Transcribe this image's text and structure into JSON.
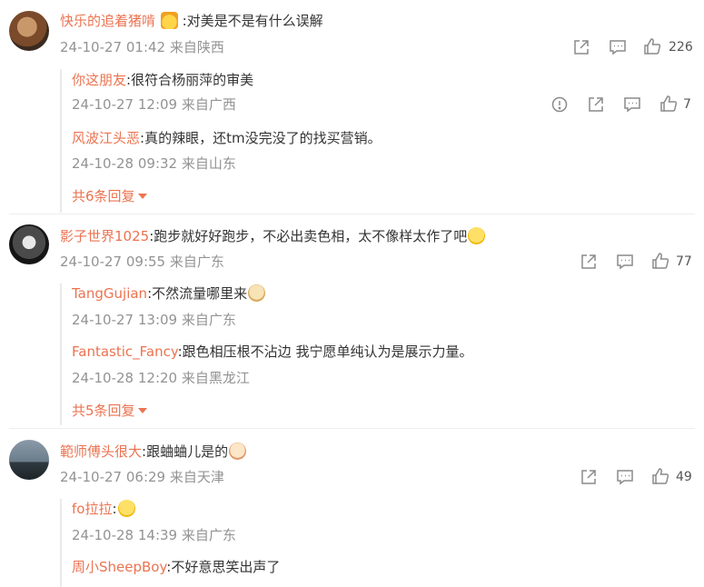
{
  "colors": {
    "username": "#eb7350",
    "meta": "#939393",
    "text": "#333333",
    "accent": "#eb7350"
  },
  "comments": [
    {
      "username": "快乐的追着猪啃",
      "badge_icon": "crown-icon",
      "text": ":对美是不是有什么误解",
      "time": "24-10-27 01:42 来自陕西",
      "likes": "226",
      "replies": [
        {
          "username": "你这朋友",
          "text": ":很符合杨丽萍的审美",
          "time": "24-10-27 12:09 来自广西",
          "likes": "7"
        },
        {
          "username": "风波江头恶",
          "text": ":真的辣眼，还tm没完没了的找买营销。",
          "time": "24-10-28 09:32 来自山东"
        }
      ],
      "more_replies": "共6条回复"
    },
    {
      "username": "影子世界1025",
      "text": ":跑步就好好跑步，不必出卖色相，太不像样太作了吧",
      "emoji": "laugh-cry-emoji",
      "time": "24-10-27 09:55 来自广东",
      "likes": "77",
      "replies": [
        {
          "username": "TangGujian",
          "text": ":不然流量哪里来",
          "emoji": "doge-emoji",
          "time": "24-10-27 13:09 来自广东"
        },
        {
          "username": "Fantastic_Fancy",
          "text": ":跟色相压根不沾边  我宁愿单纯认为是展示力量。",
          "time": "24-10-28 12:20 来自黑龙江"
        }
      ],
      "more_replies": "共5条回复"
    },
    {
      "username": "範师傅头很大",
      "text": ":跟蛐蛐儿是的",
      "emoji": "cat-emoji",
      "time": "24-10-27 06:29 来自天津",
      "likes": "49",
      "replies": [
        {
          "username": "fo拉拉",
          "text": ":",
          "emoji": "laugh-cry-emoji",
          "time": "24-10-28 14:39 来自广东"
        },
        {
          "username": "周小SheepBoy",
          "text": ":不好意思笑出声了"
        }
      ]
    }
  ]
}
